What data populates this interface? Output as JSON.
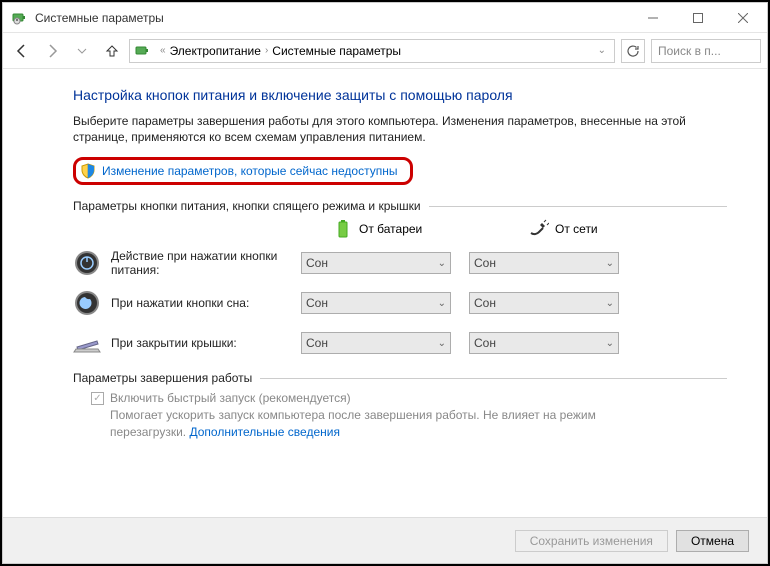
{
  "title": "Системные параметры",
  "breadcrumb": {
    "a": "Электропитание",
    "b": "Системные параметры"
  },
  "search_placeholder": "Поиск в п...",
  "heading": "Настройка кнопок питания и включение защиты с помощью пароля",
  "intro": "Выберите параметры завершения работы для этого компьютера. Изменения параметров, внесенные на этой странице, применяются ко всем схемам управления питанием.",
  "change_link": "Изменение параметров, которые сейчас недоступны",
  "section1": "Параметры кнопки питания, кнопки спящего режима и крышки",
  "cols": {
    "battery": "От батареи",
    "ac": "От сети"
  },
  "rows": [
    {
      "label": "Действие при нажатии кнопки питания:",
      "battery": "Сон",
      "ac": "Сон"
    },
    {
      "label": "При нажатии кнопки сна:",
      "battery": "Сон",
      "ac": "Сон"
    },
    {
      "label": "При закрытии крышки:",
      "battery": "Сон",
      "ac": "Сон"
    }
  ],
  "section2": "Параметры завершения работы",
  "fast_startup": {
    "label": "Включить быстрый запуск (рекомендуется)",
    "desc": "Помогает ускорить запуск компьютера после завершения работы. Не влияет на режим перезагрузки. ",
    "more": "Дополнительные сведения"
  },
  "footer": {
    "save": "Сохранить изменения",
    "cancel": "Отмена"
  }
}
